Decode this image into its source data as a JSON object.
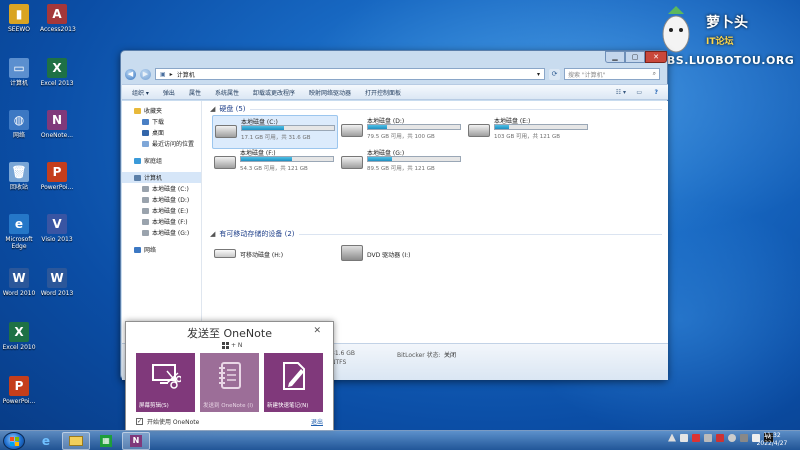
{
  "desktop": {
    "icons": [
      {
        "label": "SEEWO",
        "color": "#d9a423",
        "glyph": "▮"
      },
      {
        "label": "Access2013",
        "color": "#a4373a",
        "glyph": "A"
      },
      {
        "label": "计算机",
        "color": "#5b8fcf",
        "glyph": "▭"
      },
      {
        "label": "Excel 2013",
        "color": "#1e7145",
        "glyph": "X"
      },
      {
        "label": "网络",
        "color": "#3c78c3",
        "glyph": "◍"
      },
      {
        "label": "OneNote...",
        "color": "#80397b",
        "glyph": "N"
      },
      {
        "label": "回收站",
        "color": "#7aa6d6",
        "glyph": "🗑"
      },
      {
        "label": "PowerPoi...",
        "color": "#c43e1c",
        "glyph": "P"
      },
      {
        "label": "Microsoft Edge",
        "color": "#2577c8",
        "glyph": "e"
      },
      {
        "label": "Visio 2013",
        "color": "#3955a3",
        "glyph": "V"
      },
      {
        "label": "Word 2010",
        "color": "#2b579a",
        "glyph": "W"
      },
      {
        "label": "Word 2013",
        "color": "#2b579a",
        "glyph": "W"
      },
      {
        "label": "Excel 2010",
        "color": "#1e7145",
        "glyph": "X"
      },
      {
        "label": "PowerPoi...",
        "color": "#c43e1c",
        "glyph": "P"
      }
    ]
  },
  "watermark": {
    "title": "萝卜头",
    "subtitle": "IT论坛",
    "site": "BBS.LUOBOTOU.ORG"
  },
  "explorer": {
    "address_path": "计算机",
    "search_placeholder": "搜索 \"计算机\"",
    "toolbar": [
      "组织 ▾",
      "弹出",
      "属性",
      "系统属性",
      "卸载或更改程序",
      "映射网络驱动器",
      "打开控制面板"
    ],
    "nav": {
      "favorites_header": "收藏夹",
      "favorites": [
        "下载",
        "桌面",
        "最近访问的位置"
      ],
      "library": "家庭组",
      "computer": "计算机",
      "drives": [
        "本地磁盘 (C:)",
        "本地磁盘 (D:)",
        "本地磁盘 (E:)",
        "本地磁盘 (F:)",
        "本地磁盘 (G:)"
      ],
      "network": "网络"
    },
    "group_hdd": "硬盘 (5)",
    "group_removable": "有可移动存储的设备 (2)",
    "drives": [
      {
        "name": "本地磁盘 (C:)",
        "info": "17.1 GB 可用，共 31.6 GB",
        "used": 0.46
      },
      {
        "name": "本地磁盘 (D:)",
        "info": "79.5 GB 可用，共 100 GB",
        "used": 0.21
      },
      {
        "name": "本地磁盘 (E:)",
        "info": "103 GB 可用，共 121 GB",
        "used": 0.15
      },
      {
        "name": "本地磁盘 (F:)",
        "info": "54.3 GB 可用，共 121 GB",
        "used": 0.55
      },
      {
        "name": "本地磁盘 (G:)",
        "info": "89.5 GB 可用，共 121 GB",
        "used": 0.26
      }
    ],
    "removable": [
      {
        "name": "可移动磁盘 (H:)"
      },
      {
        "name": "DVD 驱动器 (I:)"
      }
    ],
    "details": {
      "size": "31.6 GB",
      "fs": "NTFS",
      "bitlocker_label": "BitLocker 状态:",
      "bitlocker_value": "关闭"
    }
  },
  "onenote_popup": {
    "title": "发送至 OneNote",
    "shortcut": "+ N",
    "tiles": [
      "屏幕剪辑(S)",
      "发送到 OneNote (I)",
      "新建快速笔记(N)"
    ],
    "startup_label": "开始使用 OneNote",
    "exit_label": "退出"
  },
  "taskbar": {
    "time": "11:32",
    "date": "2022/4/27",
    "ime": "M"
  }
}
